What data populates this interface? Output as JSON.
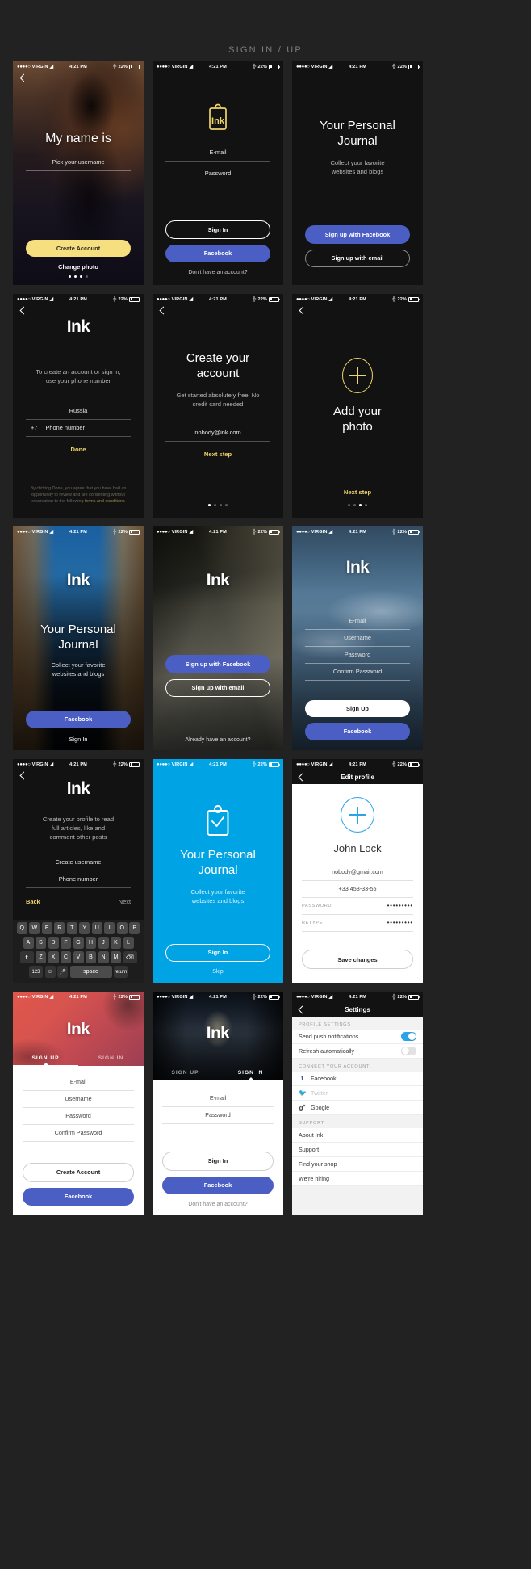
{
  "page": {
    "title": "SIGN IN / UP"
  },
  "status_bar": {
    "carrier": "VIRGIN",
    "time": "4:21 PM",
    "battery": "22%"
  },
  "brand": {
    "name": "Ink"
  },
  "screens": [
    {
      "id": "my-name-is",
      "title": "My name is",
      "placeholder": "Pick your username",
      "primary_button": "Create Account",
      "secondary_link": "Change photo",
      "dots": 4,
      "active_dot": 3
    },
    {
      "id": "sign-in",
      "email_placeholder": "E-mail",
      "password_placeholder": "Password",
      "sign_in_button": "Sign In",
      "facebook_button": "Facebook",
      "footer_link": "Don't have an account?"
    },
    {
      "id": "personal-journal-dark",
      "title_line1": "Your Personal",
      "title_line2": "Journal",
      "subtitle_line1": "Collect your favorite",
      "subtitle_line2": "websites and blogs",
      "facebook_button": "Sign up with Facebook",
      "email_button": "Sign up with email"
    },
    {
      "id": "phone-number",
      "brand": "Ink",
      "intro_line1": "To create an account or sign in,",
      "intro_line2": "use your phone number",
      "country": "Russia",
      "dial_code": "+7",
      "phone_placeholder": "Phone number",
      "done_button": "Done",
      "terms_text": "By clicking Done, you agree that you have had an opportunity to review and are consenting without reservation to the following ",
      "terms_link": "terms and conditions"
    },
    {
      "id": "create-account",
      "title_line1": "Create your",
      "title_line2": "account",
      "subtitle_line1": "Get started absolutely free. No",
      "subtitle_line2": "credit card needed",
      "email_value": "nobody@ink.com",
      "next_button": "Next step",
      "dots": 4,
      "active_dot": 0
    },
    {
      "id": "add-photo",
      "plus_icon": "plus-circle-icon",
      "title_line1": "Add your",
      "title_line2": "photo",
      "next_button": "Next step",
      "dots": 4,
      "active_dot": 2
    },
    {
      "id": "journal-street",
      "brand": "Ink",
      "title_line1": "Your Personal",
      "title_line2": "Journal",
      "subtitle_line1": "Collect your favorite",
      "subtitle_line2": "websites and blogs",
      "facebook_button": "Facebook",
      "sign_in_link": "Sign In"
    },
    {
      "id": "signup-tunnel",
      "brand": "Ink",
      "facebook_button": "Sign up with Facebook",
      "email_button": "Sign up with email",
      "footer_link": "Already have an account?"
    },
    {
      "id": "register-sky",
      "brand": "Ink",
      "email_placeholder": "E-mail",
      "username_placeholder": "Username",
      "password_placeholder": "Password",
      "confirm_placeholder": "Confirm Password",
      "sign_up_button": "Sign Up",
      "facebook_button": "Facebook"
    },
    {
      "id": "create-profile-keyboard",
      "brand": "Ink",
      "intro_line1": "Create your profile to read",
      "intro_line2": "full articles, like and",
      "intro_line3": "comment other posts",
      "username_placeholder": "Create username",
      "phone_placeholder": "Phone number",
      "back_link": "Back",
      "next_link": "Next",
      "keyboard": {
        "row1": [
          "Q",
          "W",
          "E",
          "R",
          "T",
          "Y",
          "U",
          "I",
          "O",
          "P"
        ],
        "row2": [
          "A",
          "S",
          "D",
          "F",
          "G",
          "H",
          "J",
          "K",
          "L"
        ],
        "row3": [
          "Z",
          "X",
          "C",
          "V",
          "B",
          "N",
          "M"
        ],
        "shift": "shift-icon",
        "backspace": "backspace-icon",
        "numbers": "123",
        "emoji": "emoji-icon",
        "mic": "microphone-icon",
        "space": "space",
        "return": "return"
      }
    },
    {
      "id": "journal-blue",
      "icon": "clipboard-check-icon",
      "title_line1": "Your Personal",
      "title_line2": "Journal",
      "subtitle_line1": "Collect your favorite",
      "subtitle_line2": "websites and blogs",
      "sign_in_button": "Sign In",
      "skip_link": "Skip"
    },
    {
      "id": "edit-profile",
      "nav_title": "Edit profile",
      "plus_icon": "plus-circle-icon",
      "name": "John Lock",
      "email": "nobody@gmail.com",
      "phone": "+33 453-33-55",
      "password_label": "PASSWORD",
      "password_value": "•••••••••",
      "retype_label": "RETYPE",
      "retype_value": "•••••••••",
      "save_button": "Save changes"
    },
    {
      "id": "signup-leaf",
      "brand": "Ink",
      "tab_signup": "SIGN UP",
      "tab_signin": "SIGN IN",
      "active_tab": "SIGN UP",
      "email_placeholder": "E-mail",
      "username_placeholder": "Username",
      "password_placeholder": "Password",
      "confirm_placeholder": "Confirm Password",
      "create_account_button": "Create Account",
      "facebook_button": "Facebook"
    },
    {
      "id": "signin-night",
      "brand": "Ink",
      "tab_signup": "SIGN UP",
      "tab_signin": "SIGN IN",
      "active_tab": "SIGN IN",
      "email_placeholder": "E-mail",
      "password_placeholder": "Password",
      "sign_in_button": "Sign In",
      "facebook_button": "Facebook",
      "footer_link": "Don't have an account?"
    },
    {
      "id": "settings",
      "nav_title": "Settings",
      "sections": [
        {
          "header": "PROFILE SETTINGS",
          "rows": [
            {
              "label": "Send push notifications",
              "toggle": "on"
            },
            {
              "label": "Refresh automatically",
              "toggle": "off"
            }
          ]
        },
        {
          "header": "CONNECT YOUR ACCOUNT",
          "rows": [
            {
              "label": "Facebook",
              "icon": "facebook-icon"
            },
            {
              "label": "Twitter",
              "icon": "twitter-icon",
              "dim": true
            },
            {
              "label": "Google",
              "icon": "google-plus-icon"
            }
          ]
        },
        {
          "header": "SUPPORT",
          "rows": [
            {
              "label": "About Ink"
            },
            {
              "label": "Support"
            },
            {
              "label": "Find your shop"
            },
            {
              "label": "We're hiring"
            }
          ]
        }
      ]
    }
  ],
  "colors": {
    "accent_yellow": "#f6df7e",
    "facebook_blue": "#4a5ec4",
    "brand_blue": "#00a4e4",
    "toggle_on": "#2aa3e8",
    "page_bg": "#222222",
    "card_bg": "#121212"
  }
}
